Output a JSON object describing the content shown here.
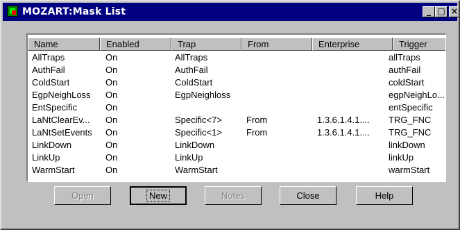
{
  "window": {
    "title": "MOZART:Mask List",
    "icon": "mozart-app-icon"
  },
  "title_buttons": {
    "minimize": "_",
    "maximize": "□",
    "close": "×"
  },
  "columns": [
    "Name",
    "Enabled",
    "Trap",
    "From",
    "Enterprise",
    "Trigger"
  ],
  "rows": [
    {
      "name": "AllTraps",
      "enabled": "On",
      "trap": "AllTraps",
      "from": "",
      "enterprise": "",
      "trigger": "allTraps"
    },
    {
      "name": "AuthFail",
      "enabled": "On",
      "trap": "AuthFail",
      "from": "",
      "enterprise": "",
      "trigger": "authFail"
    },
    {
      "name": "ColdStart",
      "enabled": "On",
      "trap": "ColdStart",
      "from": "",
      "enterprise": "",
      "trigger": "coldStart"
    },
    {
      "name": "EgpNeighLoss",
      "enabled": "On",
      "trap": "EgpNeighloss",
      "from": "",
      "enterprise": "",
      "trigger": "egpNeighLo..."
    },
    {
      "name": "EntSpecific",
      "enabled": "On",
      "trap": "",
      "from": "",
      "enterprise": "",
      "trigger": "entSpecific"
    },
    {
      "name": "LaNtClearEv...",
      "enabled": "On",
      "trap": "Specific<7>",
      "from": "From",
      "enterprise": "1.3.6.1.4.1....",
      "trigger": "TRG_FNC"
    },
    {
      "name": "LaNtSetEvents",
      "enabled": "On",
      "trap": "Specific<1>",
      "from": "From",
      "enterprise": "1.3.6.1.4.1....",
      "trigger": "TRG_FNC"
    },
    {
      "name": "LinkDown",
      "enabled": "On",
      "trap": "LinkDown",
      "from": "",
      "enterprise": "",
      "trigger": "linkDown"
    },
    {
      "name": "LinkUp",
      "enabled": "On",
      "trap": "LinkUp",
      "from": "",
      "enterprise": "",
      "trigger": "linkUp"
    },
    {
      "name": "WarmStart",
      "enabled": "On",
      "trap": "WarmStart",
      "from": "",
      "enterprise": "",
      "trigger": "warmStart"
    }
  ],
  "buttons": {
    "open": {
      "label": "Open",
      "enabled": false
    },
    "new": {
      "label": "New",
      "enabled": true,
      "default": true
    },
    "notes": {
      "label": "Notes",
      "enabled": false
    },
    "close": {
      "label": "Close",
      "enabled": true
    },
    "help": {
      "label": "Help",
      "enabled": true
    }
  }
}
